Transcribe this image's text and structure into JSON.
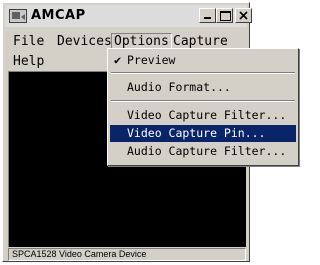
{
  "window": {
    "title": "AMCAP"
  },
  "menubar": {
    "file": "File",
    "devices": "Devices",
    "options": "Options",
    "capture": "Capture",
    "help": "Help"
  },
  "options_menu": {
    "preview": "Preview",
    "preview_checked": true,
    "audio_format": "Audio Format...",
    "video_capture_filter": "Video Capture Filter...",
    "video_capture_pin": "Video Capture Pin...",
    "audio_capture_filter": "Audio Capture Filter...",
    "selected_item": "Video Capture Pin..."
  },
  "status": {
    "device": "SPCA1528 Video Camera Device"
  },
  "colors": {
    "highlight": "#0a246a",
    "video_background": "#000000",
    "window_face": "#d4d0c8"
  },
  "icons": {
    "app": "camera-icon",
    "minimize": "minimize-icon",
    "maximize": "maximize-icon",
    "close": "close-icon",
    "check": "checkmark-icon"
  }
}
